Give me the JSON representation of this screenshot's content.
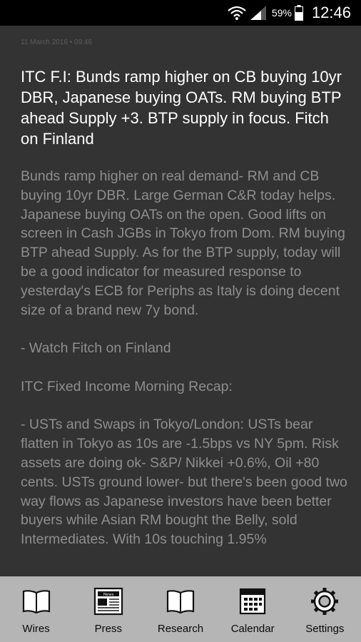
{
  "status_bar": {
    "battery": "59%",
    "time": "12:46",
    "icons": [
      "wifi-icon",
      "signal-icon",
      "battery-icon"
    ]
  },
  "article": {
    "meta": "11 March 2016 • 09:46",
    "title": "ITC F.I: Bunds ramp higher on CB buying 10yr DBR, Japanese buying OATs. RM buying BTP ahead Supply +3. BTP supply in focus. Fitch on Finland",
    "paragraphs": [
      "Bunds ramp higher on real demand- RM and CB buying 10yr DBR. Large German C&R today helps. Japanese buying OATs on the open. Good lifts on screen in Cash JGBs in Tokyo from Dom. RM buying BTP ahead Supply. As for the BTP supply, today will be a good indicator for measured response to yesterday's ECB for Periphs as Italy is doing decent size of a brand new 7y bond.",
      "- Watch Fitch on Finland",
      "ITC Fixed Income Morning Recap:",
      "- USTs and Swaps in Tokyo/London: USTs bear flatten in Tokyo as 10s are -1.5bps vs NY 5pm. Risk assets are doing ok- S&P/ Nikkei +0.6%, Oil +80 cents. USTs ground lower- but there's been good two way flows as Japanese investors have been better buyers while Asian RM bought the Belly, sold Intermediates. With 10s touching 1.95%"
    ]
  },
  "nav": [
    {
      "label": "Wires",
      "icon": "book-icon"
    },
    {
      "label": "Press",
      "icon": "newspaper-icon"
    },
    {
      "label": "Research",
      "icon": "book-icon"
    },
    {
      "label": "Calendar",
      "icon": "calendar-icon"
    },
    {
      "label": "Settings",
      "icon": "gear-icon"
    }
  ]
}
